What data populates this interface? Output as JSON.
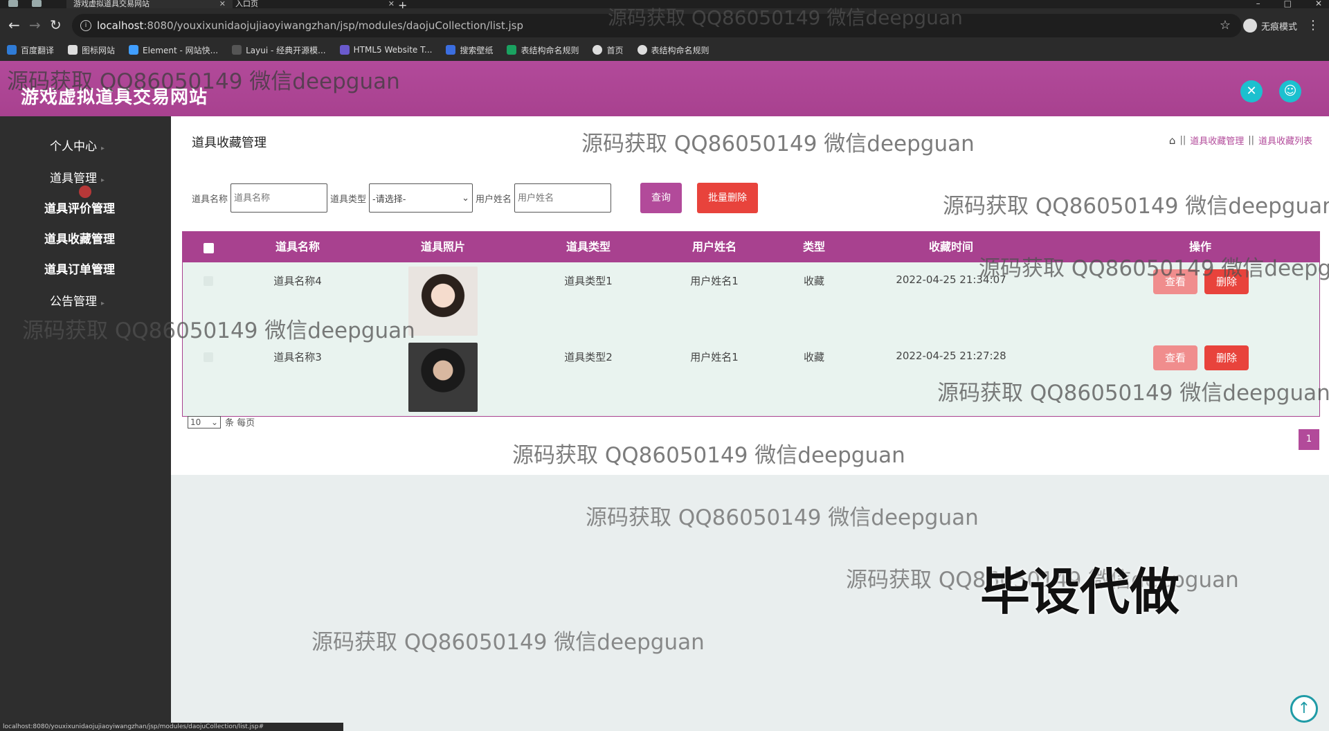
{
  "browser": {
    "tabs": [
      {
        "title": "游戏虚拟道具交易网站",
        "active": true
      },
      {
        "title": "入口页",
        "active": false
      }
    ],
    "url_host": "localhost",
    "url_rest": ":8080/youxixunidaojujiaoyiwangzhan/jsp/modules/daojuCollection/list.jsp",
    "incognito_label": "无痕模式",
    "bookmarks": [
      "百度翻译",
      "图标网站",
      "Element - 网站快...",
      "Layui - 经典开源模...",
      "HTML5 Website T...",
      "搜索壁纸",
      "表结构命名规则",
      "首页",
      "表结构命名规则"
    ],
    "status_url": "localhost:8080/youxixunidaojujiaoyiwangzhan/jsp/modules/daojuCollection/list.jsp#"
  },
  "header": {
    "site_title": "游戏虚拟道具交易网站"
  },
  "sidebar": {
    "items": [
      {
        "label": "个人中心"
      },
      {
        "label": "道具管理"
      },
      {
        "label": "道具评价管理"
      },
      {
        "label": "道具收藏管理"
      },
      {
        "label": "道具订单管理"
      },
      {
        "label": "公告管理"
      }
    ]
  },
  "main": {
    "page_heading": "道具收藏管理",
    "breadcrumb": [
      "道具收藏管理",
      "道具收藏列表"
    ],
    "search": {
      "name_label": "道具名称",
      "name_placeholder": "道具名称",
      "type_label": "道具类型",
      "type_selected": "-请选择-",
      "user_label": "用户姓名",
      "user_placeholder": "用户姓名",
      "query_button": "查询",
      "batch_delete_button": "批量删除"
    },
    "table": {
      "columns": [
        "道具名称",
        "道具照片",
        "道具类型",
        "用户姓名",
        "类型",
        "收藏时间",
        "操作"
      ],
      "rows": [
        {
          "name": "道具名称4",
          "type": "道具类型1",
          "user": "用户姓名1",
          "kind": "收藏",
          "time": "2022-04-25 21:34:07",
          "view": "查看",
          "delete": "删除"
        },
        {
          "name": "道具名称3",
          "type": "道具类型2",
          "user": "用户姓名1",
          "kind": "收藏",
          "time": "2022-04-25 21:27:28",
          "view": "查看",
          "delete": "删除"
        }
      ]
    },
    "pager": {
      "page_size": "10",
      "per_page_label": "条 每页",
      "current_page": "1"
    }
  },
  "watermark_text": "源码获取 QQ86050149 微信deepguan",
  "overlay_text": "毕设代做",
  "colors": {
    "brand": "#a8418f",
    "danger": "#e8433c",
    "accent": "#1cc0cf"
  }
}
